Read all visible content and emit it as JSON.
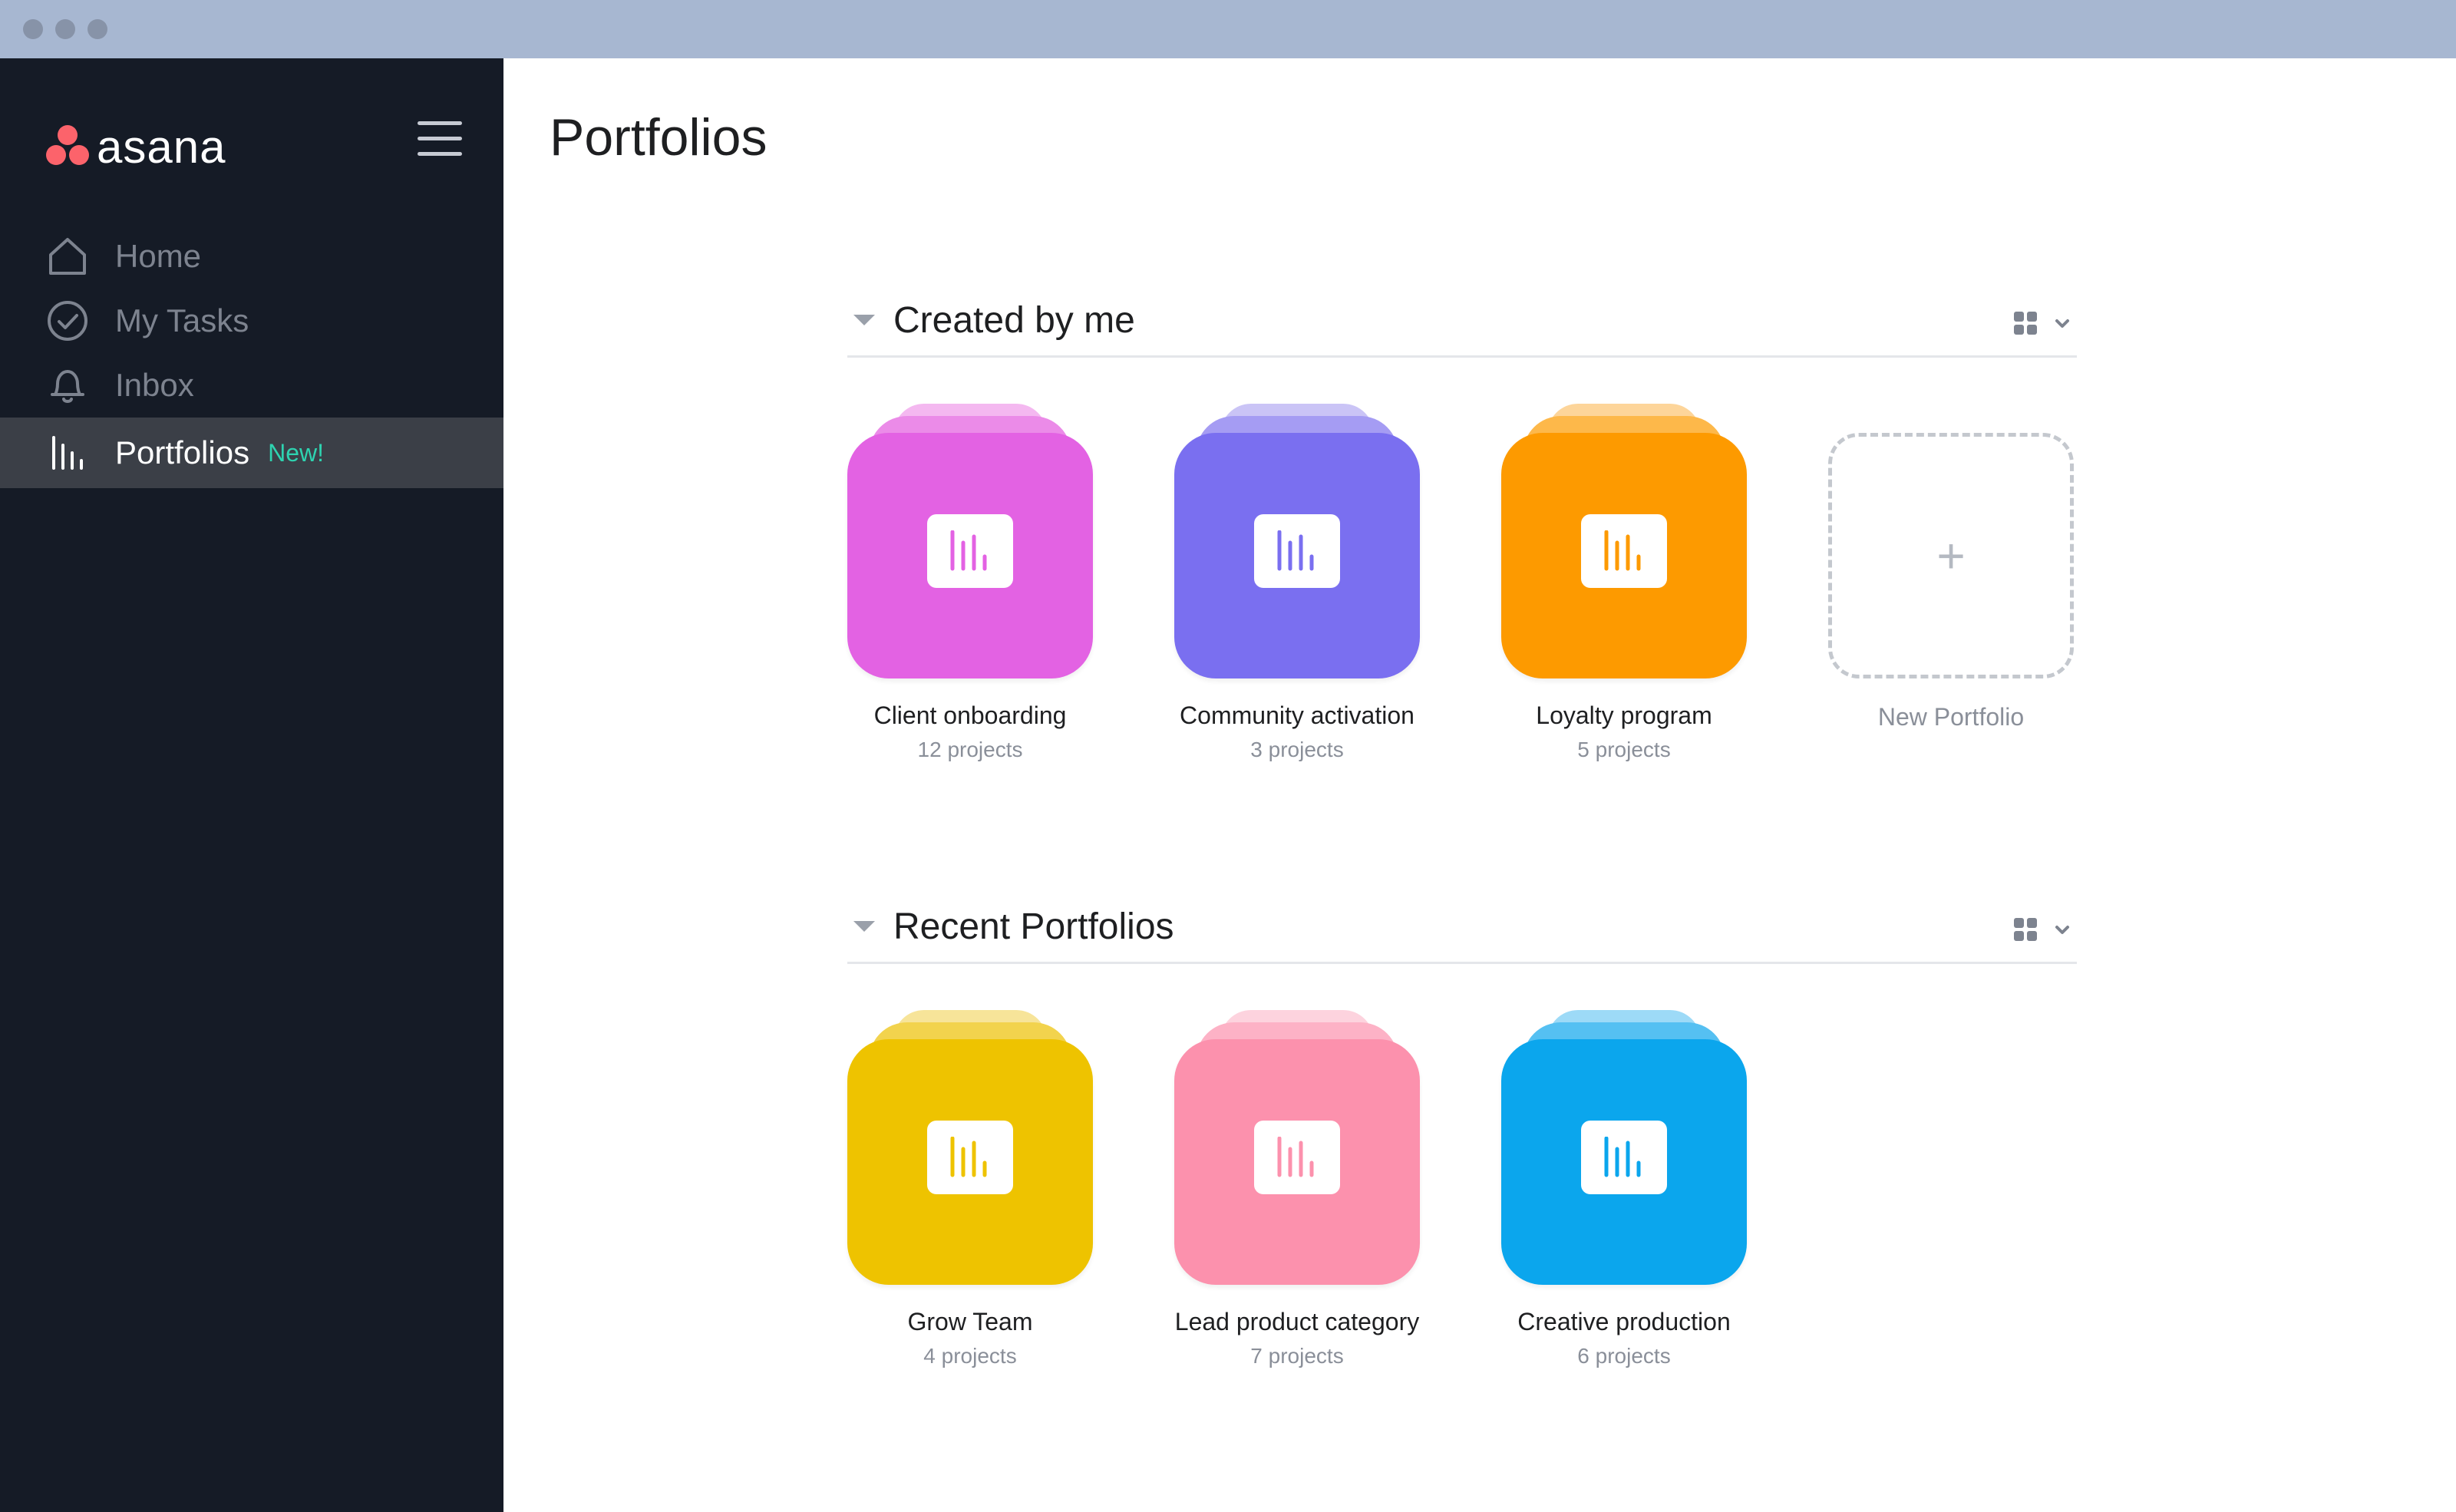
{
  "app": {
    "logo_text": "asana"
  },
  "sidebar": {
    "items": [
      {
        "label": "Home",
        "icon": "home-icon"
      },
      {
        "label": "My Tasks",
        "icon": "check-circle-icon"
      },
      {
        "label": "Inbox",
        "icon": "bell-icon"
      },
      {
        "label": "Portfolios",
        "icon": "bar-chart-icon",
        "badge": "New!",
        "active": true
      }
    ]
  },
  "main": {
    "title": "Portfolios",
    "sections": [
      {
        "title": "Created by me",
        "portfolios": [
          {
            "name": "Client onboarding",
            "meta": "12 projects",
            "color": "#e362e3",
            "back": "#f4b8f0",
            "back2": "#eb8be8"
          },
          {
            "name": "Community activation",
            "meta": "3 projects",
            "color": "#7a6ff0",
            "back": "#cac4f6",
            "back2": "#a59cf3"
          },
          {
            "name": "Loyalty program",
            "meta": "5 projects",
            "color": "#fd9a00",
            "back": "#fdd59a",
            "back2": "#fdb84a"
          }
        ],
        "new_label": "New Portfolio",
        "new_symbol": "+"
      },
      {
        "title": "Recent Portfolios",
        "portfolios": [
          {
            "name": "Grow Team",
            "meta": "4 projects",
            "color": "#eec300",
            "back": "#f7e499",
            "back2": "#f2d34d"
          },
          {
            "name": "Lead product category",
            "meta": "7 projects",
            "color": "#fc91ad",
            "back": "#fdd3de",
            "back2": "#fdb2c6"
          },
          {
            "name": "Creative production",
            "meta": "6 projects",
            "color": "#0ba6ed",
            "back": "#9ddaf7",
            "back2": "#55c0f2"
          }
        ]
      }
    ]
  }
}
